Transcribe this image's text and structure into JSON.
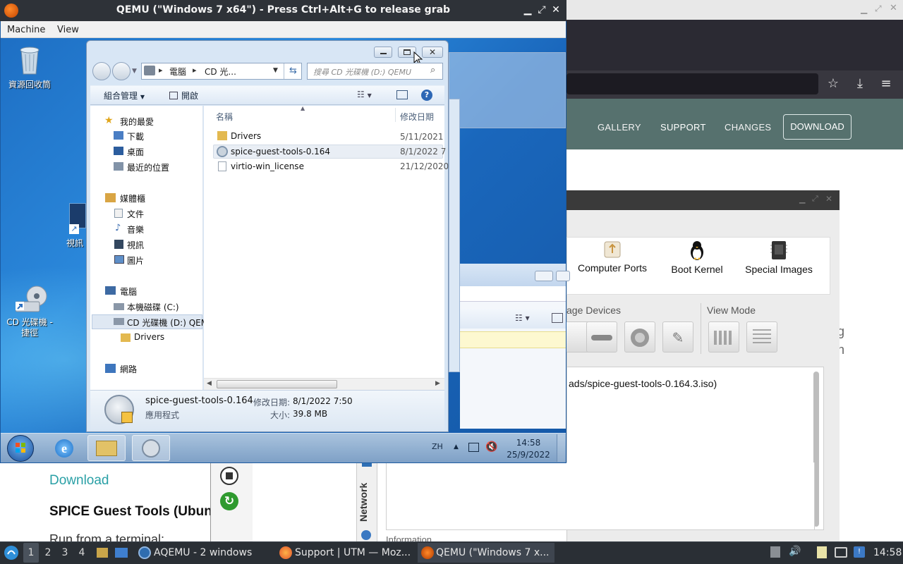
{
  "firefox": {
    "nav": {
      "gallery": "GALLERY",
      "support": "SUPPORT",
      "changes": "CHANGES",
      "download": "DOWNLOAD"
    },
    "page_right_g": "g",
    "page_right_h": "h",
    "page_download_link": "Download",
    "page_heading": "SPICE Guest Tools (Ubun",
    "page_run": "Run from a terminal:"
  },
  "utm": {
    "tools": [
      "Computer Ports",
      "Boot Kernel",
      "Special Images"
    ],
    "sections": {
      "storage": "age Devices",
      "view_mode": "View Mode"
    },
    "log_line": "ads/spice-guest-tools-0.164.3.iso)",
    "sidebar_tab": "Network",
    "info_label": "Information"
  },
  "qemu": {
    "title": "QEMU (\"Windows 7 x64\") - Press Ctrl+Alt+G to release grab",
    "menu": [
      "Machine",
      "View"
    ]
  },
  "desktop": {
    "recycle_bin": "資源回收筒",
    "video_shortcut": "視訊",
    "cd_shortcut": "CD 光碟機 - 捷徑"
  },
  "explorer": {
    "breadcrumb": [
      "電腦",
      "CD 光..."
    ],
    "search_placeholder": "搜尋 CD 光碟機 (D:) QEMU",
    "toolbar": {
      "organize": "組合管理",
      "open": "開啟"
    },
    "nav_tree": {
      "favorites": "我的最愛",
      "downloads": "下載",
      "desktop": "桌面",
      "recent": "最近的位置",
      "libraries": "媒體櫃",
      "documents": "文件",
      "music": "音樂",
      "videos": "視訊",
      "pictures": "圖片",
      "computer": "電腦",
      "local_disk": "本機磁碟 (C:)",
      "cd_drive": "CD 光碟機 (D:) QEM",
      "drivers": "Drivers",
      "network": "網路"
    },
    "columns": {
      "name": "名稱",
      "modified": "修改日期"
    },
    "files": [
      {
        "name": "Drivers",
        "date": "5/11/2021"
      },
      {
        "name": "spice-guest-tools-0.164",
        "date": "8/1/2022 7"
      },
      {
        "name": "virtio-win_license",
        "date": "21/12/2020"
      }
    ],
    "details": {
      "name": "spice-guest-tools-0.164",
      "type": "應用程式",
      "modified_label": "修改日期:",
      "modified_value": "8/1/2022 7:50",
      "size_label": "大小:",
      "size_value": "39.8 MB"
    }
  },
  "win_taskbar": {
    "lang": "ZH",
    "time": "14:58",
    "date": "25/9/2022"
  },
  "host_panel": {
    "workspaces": [
      "1",
      "2",
      "3",
      "4"
    ],
    "tasks": [
      {
        "label": "AQEMU - 2 windows"
      },
      {
        "label": "Support | UTM — Moz..."
      },
      {
        "label": "QEMU (\"Windows 7 x..."
      }
    ],
    "clock": "14:58"
  },
  "colors": {
    "accent_teal": "#56716e",
    "link": "#2aa0a6",
    "win7_blue": "#2b89dc"
  }
}
